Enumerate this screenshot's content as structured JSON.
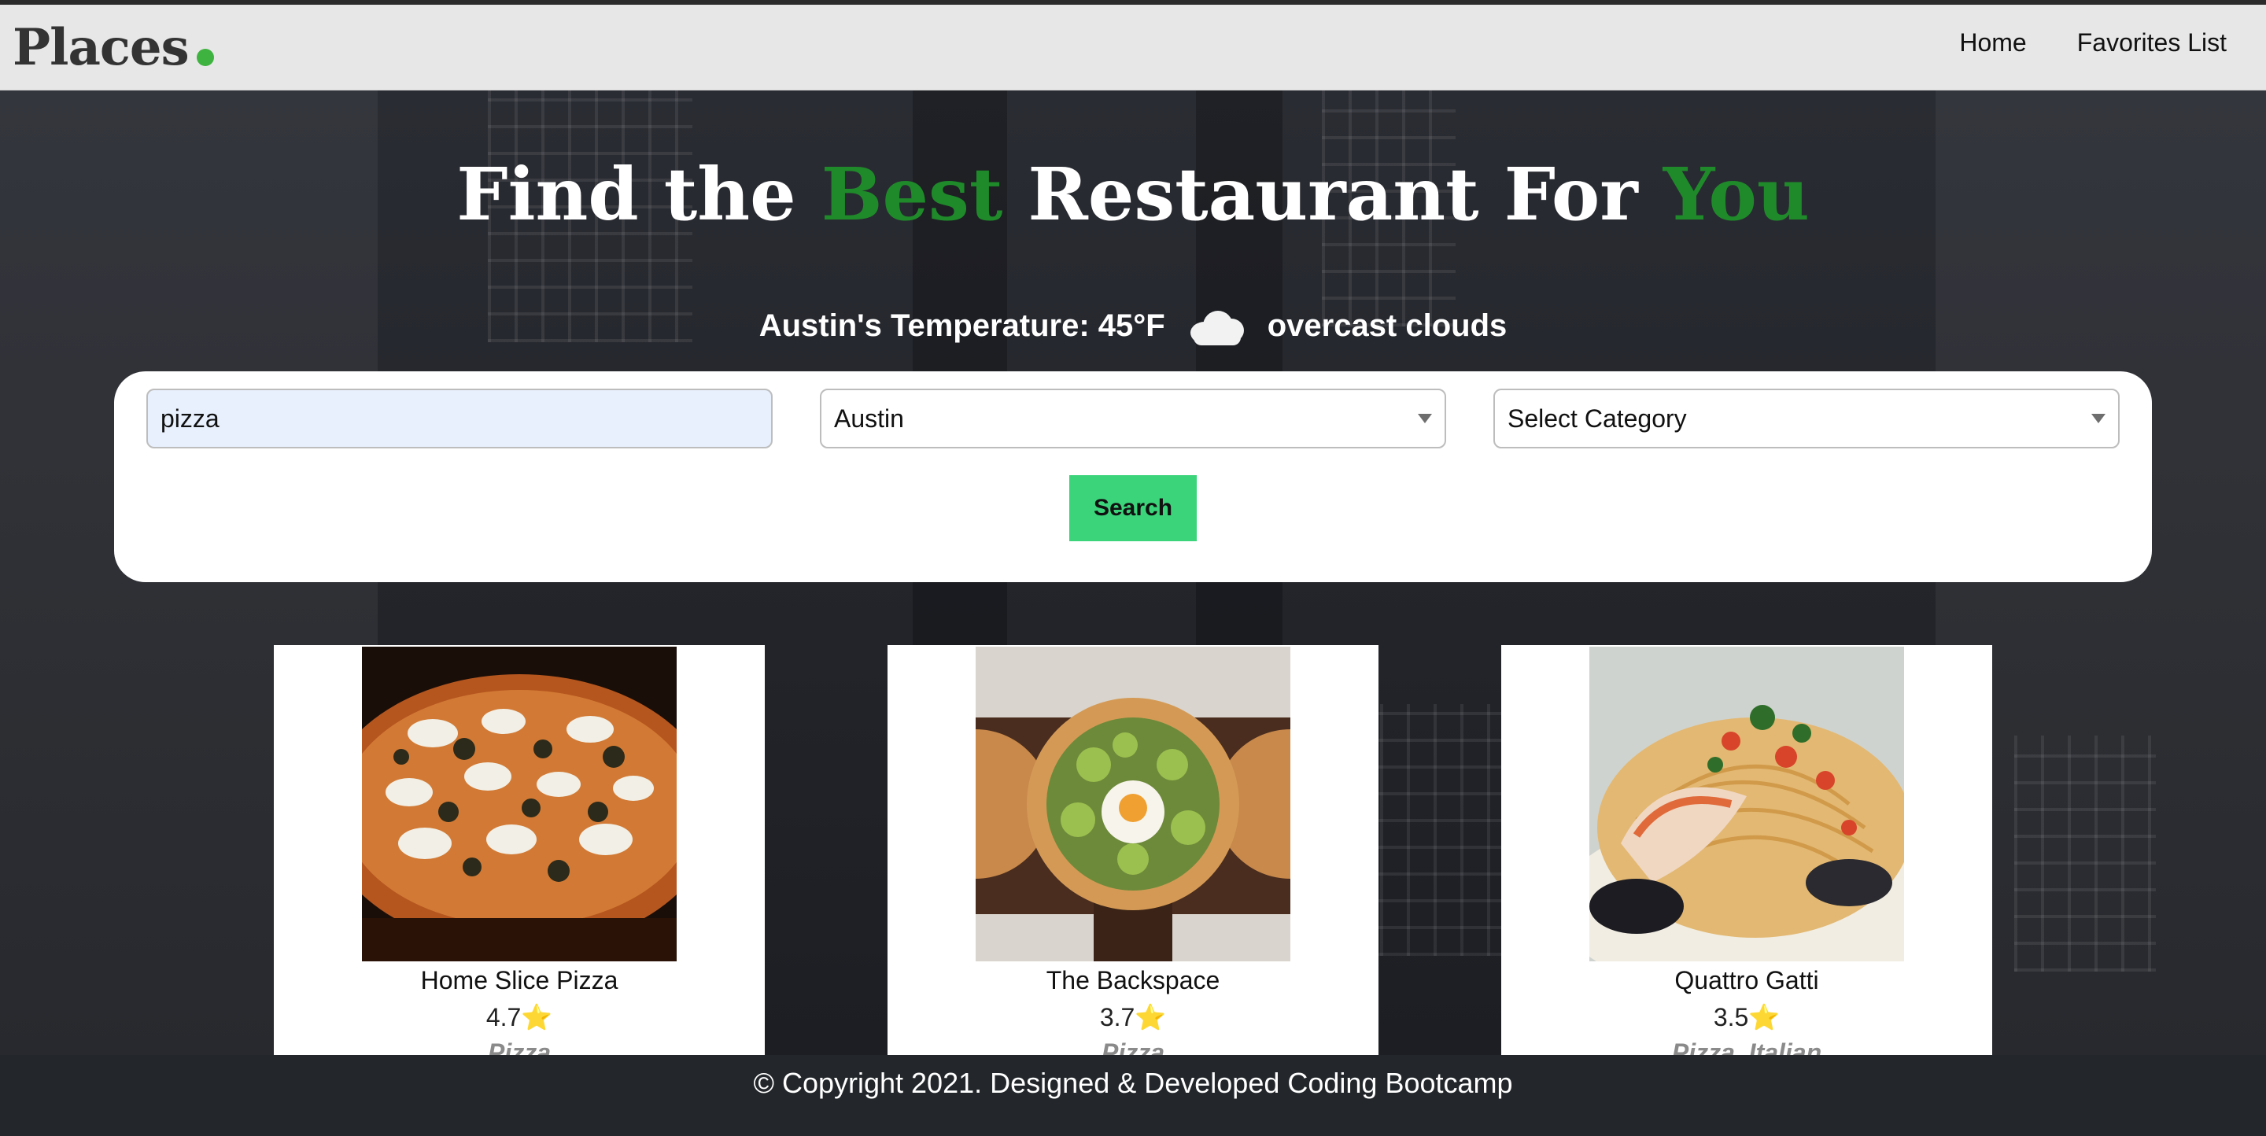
{
  "nav": {
    "brand": "Places",
    "links": [
      "Home",
      "Favorites List"
    ]
  },
  "hero": {
    "title_parts": [
      "Find the ",
      "Best",
      " Restaurant For ",
      "You"
    ],
    "weather": {
      "label": "Austin's Temperature: 45°F",
      "description": "overcast clouds",
      "icon": "cloud-icon"
    }
  },
  "search": {
    "query_value": "pizza",
    "city_selected": "Austin",
    "category_selected": "Select Category",
    "button_label": "Search"
  },
  "results": [
    {
      "name": "Home Slice Pizza",
      "rating": "4.7",
      "category": "Pizza",
      "image": "pizza-photo"
    },
    {
      "name": "The Backspace",
      "rating": "3.7",
      "category": "Pizza",
      "image": "pizza-photo"
    },
    {
      "name": "Quattro Gatti",
      "rating": "3.5",
      "category": "Pizza, Italian",
      "image": "seafood-pasta-photo"
    }
  ],
  "rating_star": "⭐",
  "footer": {
    "text": "© Copyright 2021. Designed & Developed Coding Bootcamp"
  },
  "colors": {
    "accent_green": "#1f8a2a",
    "button_green": "#3bd47b",
    "brand_dot": "#3fb33f"
  }
}
